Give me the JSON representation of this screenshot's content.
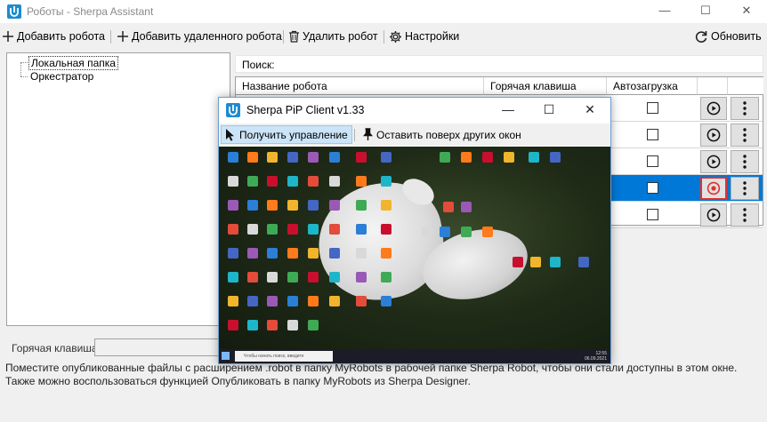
{
  "window": {
    "title": "Роботы - Sherpa Assistant",
    "minimize": "—",
    "maximize": "☐",
    "close": "✕"
  },
  "toolbar": {
    "add_robot": "Добавить робота",
    "add_remote_robot": "Добавить удаленного робота",
    "delete_robot": "Удалить робот",
    "settings": "Настройки",
    "refresh": "Обновить"
  },
  "tree": {
    "items": [
      "Локальная папка",
      "Оркестратор"
    ]
  },
  "search": {
    "label": "Поиск:",
    "value": ""
  },
  "grid": {
    "columns": [
      "Название робота",
      "Горячая клавиша",
      "Автозагрузка"
    ],
    "rows": [
      {
        "name": "",
        "hotkey": "",
        "autostart": false,
        "state": "run"
      },
      {
        "name": "",
        "hotkey": "",
        "autostart": false,
        "state": "run"
      },
      {
        "name": "",
        "hotkey": "",
        "autostart": false,
        "state": "run"
      },
      {
        "name": "",
        "hotkey": "",
        "autostart": false,
        "state": "stop",
        "selected": true
      },
      {
        "name": "",
        "hotkey": "",
        "autostart": false,
        "state": "run"
      }
    ]
  },
  "bottom": {
    "hotkey_label": "Горячая клавиша:",
    "hotkey_value": "",
    "info_text": "Поместите опубликованные файлы с расширением .robot в папку MyRobots в рабочей папке Sherpa Robot, чтобы они стали доступны в этом окне. Также можно воспользоваться функцией Опубликовать в папку MyRobots из Sherpa Designer."
  },
  "pip": {
    "title": "Sherpa PiP Client v1.33",
    "minimize": "—",
    "maximize": "☐",
    "close": "✕",
    "take_control": "Получить управление",
    "stay_on_top": "Оставить поверх других окон",
    "desktop": {
      "taskbar_search": "Чтобы начать поиск, введите",
      "tray_time": "12:55",
      "tray_date": "06.09.2021"
    }
  },
  "colors": {
    "accent": "#0078d7",
    "stop_highlight": "#e0312b",
    "brand_icon": "#1e8bd0"
  }
}
